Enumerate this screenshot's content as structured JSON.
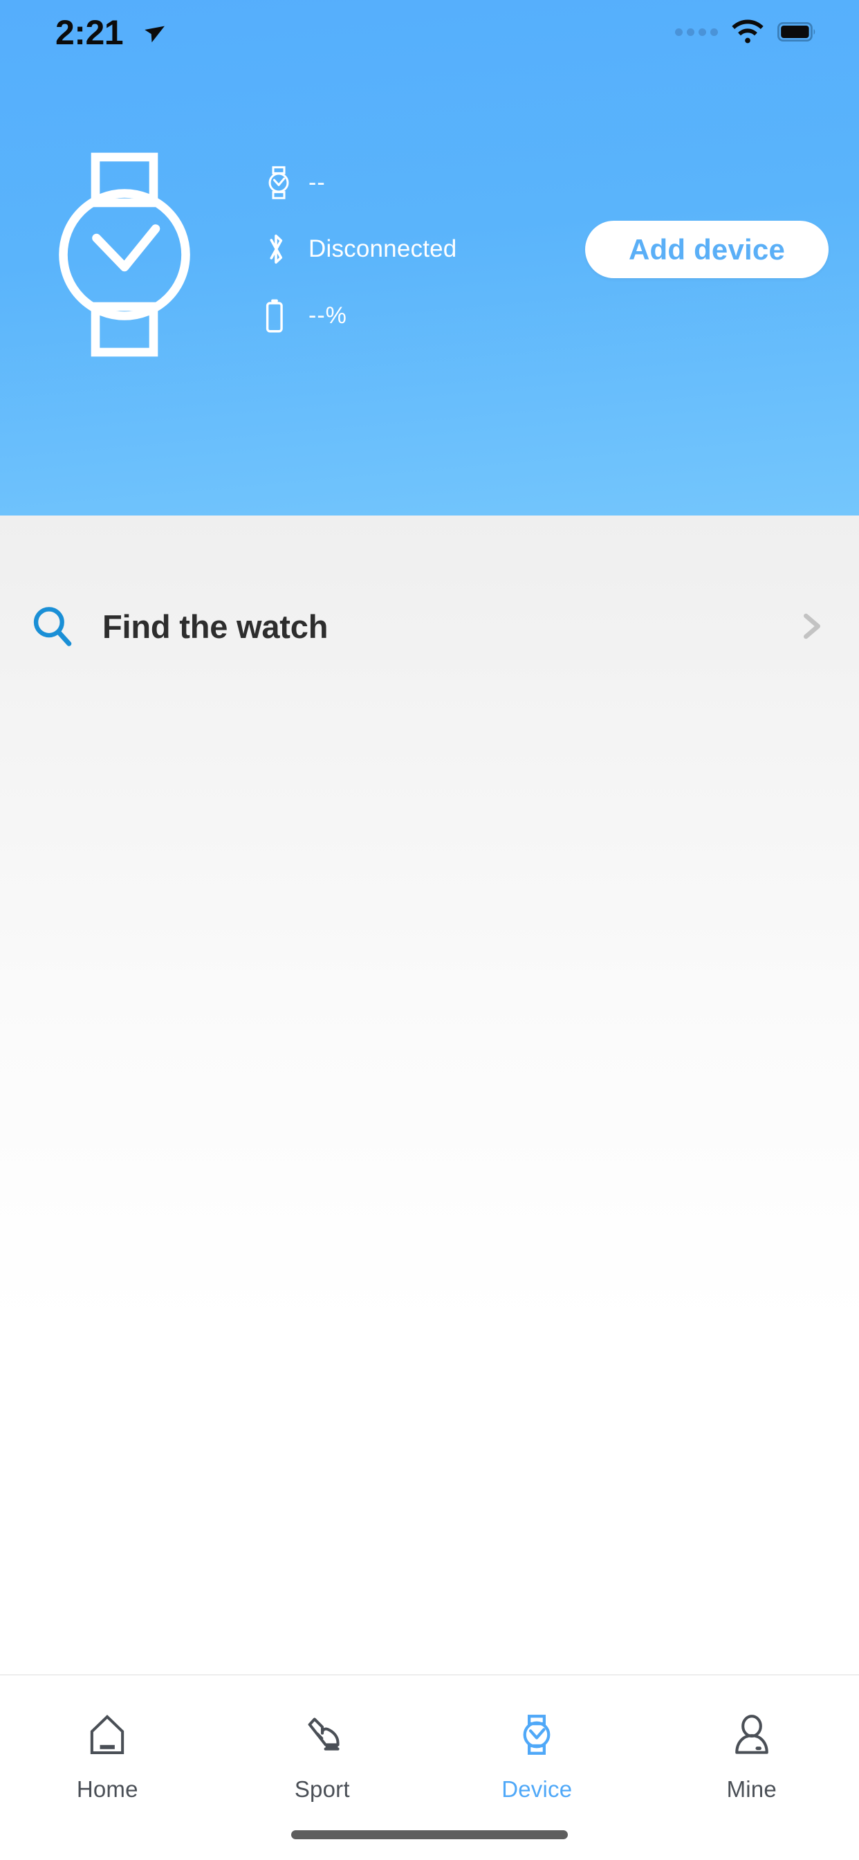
{
  "status_bar": {
    "time": "2:21",
    "location_icon": "location-arrow-icon",
    "cellular_icon": "signal-dots-icon",
    "wifi_icon": "wifi-icon",
    "battery_icon": "battery-full-icon"
  },
  "header": {
    "watch_illustration_icon": "watch-outline-icon",
    "device": {
      "name_icon": "watch-small-icon",
      "name": "--",
      "bluetooth_icon": "bluetooth-icon",
      "connection_status": "Disconnected",
      "battery_icon": "battery-vertical-icon",
      "battery_level": "--%"
    },
    "add_device_label": "Add device",
    "background_color": "#5ab4fb",
    "accent_color": "#5aaff7"
  },
  "main": {
    "rows": [
      {
        "icon": "search-icon",
        "label": "Find the watch",
        "chevron": "chevron-right-icon"
      }
    ]
  },
  "tabbar": {
    "items": [
      {
        "label": "Home",
        "icon": "home-icon",
        "active": false
      },
      {
        "label": "Sport",
        "icon": "shoe-icon",
        "active": false
      },
      {
        "label": "Device",
        "icon": "watch-icon",
        "active": true
      },
      {
        "label": "Mine",
        "icon": "person-icon",
        "active": false
      }
    ],
    "active_color": "#4fa8f8",
    "inactive_color": "#4a4f56"
  }
}
